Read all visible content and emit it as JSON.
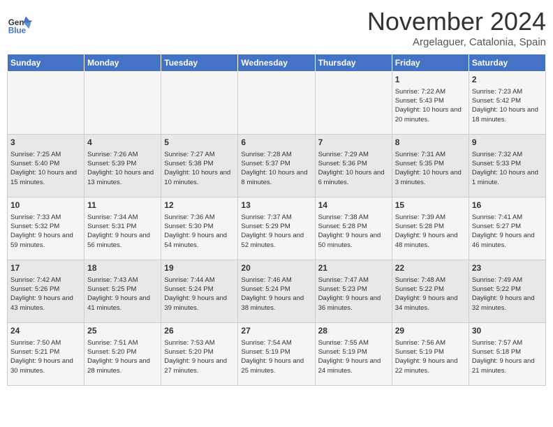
{
  "header": {
    "logo_line1": "General",
    "logo_line2": "Blue",
    "month": "November 2024",
    "location": "Argelaguer, Catalonia, Spain"
  },
  "weekdays": [
    "Sunday",
    "Monday",
    "Tuesday",
    "Wednesday",
    "Thursday",
    "Friday",
    "Saturday"
  ],
  "weeks": [
    [
      {
        "day": "",
        "info": ""
      },
      {
        "day": "",
        "info": ""
      },
      {
        "day": "",
        "info": ""
      },
      {
        "day": "",
        "info": ""
      },
      {
        "day": "",
        "info": ""
      },
      {
        "day": "1",
        "info": "Sunrise: 7:22 AM\nSunset: 5:43 PM\nDaylight: 10 hours and 20 minutes."
      },
      {
        "day": "2",
        "info": "Sunrise: 7:23 AM\nSunset: 5:42 PM\nDaylight: 10 hours and 18 minutes."
      }
    ],
    [
      {
        "day": "3",
        "info": "Sunrise: 7:25 AM\nSunset: 5:40 PM\nDaylight: 10 hours and 15 minutes."
      },
      {
        "day": "4",
        "info": "Sunrise: 7:26 AM\nSunset: 5:39 PM\nDaylight: 10 hours and 13 minutes."
      },
      {
        "day": "5",
        "info": "Sunrise: 7:27 AM\nSunset: 5:38 PM\nDaylight: 10 hours and 10 minutes."
      },
      {
        "day": "6",
        "info": "Sunrise: 7:28 AM\nSunset: 5:37 PM\nDaylight: 10 hours and 8 minutes."
      },
      {
        "day": "7",
        "info": "Sunrise: 7:29 AM\nSunset: 5:36 PM\nDaylight: 10 hours and 6 minutes."
      },
      {
        "day": "8",
        "info": "Sunrise: 7:31 AM\nSunset: 5:35 PM\nDaylight: 10 hours and 3 minutes."
      },
      {
        "day": "9",
        "info": "Sunrise: 7:32 AM\nSunset: 5:33 PM\nDaylight: 10 hours and 1 minute."
      }
    ],
    [
      {
        "day": "10",
        "info": "Sunrise: 7:33 AM\nSunset: 5:32 PM\nDaylight: 9 hours and 59 minutes."
      },
      {
        "day": "11",
        "info": "Sunrise: 7:34 AM\nSunset: 5:31 PM\nDaylight: 9 hours and 56 minutes."
      },
      {
        "day": "12",
        "info": "Sunrise: 7:36 AM\nSunset: 5:30 PM\nDaylight: 9 hours and 54 minutes."
      },
      {
        "day": "13",
        "info": "Sunrise: 7:37 AM\nSunset: 5:29 PM\nDaylight: 9 hours and 52 minutes."
      },
      {
        "day": "14",
        "info": "Sunrise: 7:38 AM\nSunset: 5:28 PM\nDaylight: 9 hours and 50 minutes."
      },
      {
        "day": "15",
        "info": "Sunrise: 7:39 AM\nSunset: 5:28 PM\nDaylight: 9 hours and 48 minutes."
      },
      {
        "day": "16",
        "info": "Sunrise: 7:41 AM\nSunset: 5:27 PM\nDaylight: 9 hours and 46 minutes."
      }
    ],
    [
      {
        "day": "17",
        "info": "Sunrise: 7:42 AM\nSunset: 5:26 PM\nDaylight: 9 hours and 43 minutes."
      },
      {
        "day": "18",
        "info": "Sunrise: 7:43 AM\nSunset: 5:25 PM\nDaylight: 9 hours and 41 minutes."
      },
      {
        "day": "19",
        "info": "Sunrise: 7:44 AM\nSunset: 5:24 PM\nDaylight: 9 hours and 39 minutes."
      },
      {
        "day": "20",
        "info": "Sunrise: 7:46 AM\nSunset: 5:24 PM\nDaylight: 9 hours and 38 minutes."
      },
      {
        "day": "21",
        "info": "Sunrise: 7:47 AM\nSunset: 5:23 PM\nDaylight: 9 hours and 36 minutes."
      },
      {
        "day": "22",
        "info": "Sunrise: 7:48 AM\nSunset: 5:22 PM\nDaylight: 9 hours and 34 minutes."
      },
      {
        "day": "23",
        "info": "Sunrise: 7:49 AM\nSunset: 5:22 PM\nDaylight: 9 hours and 32 minutes."
      }
    ],
    [
      {
        "day": "24",
        "info": "Sunrise: 7:50 AM\nSunset: 5:21 PM\nDaylight: 9 hours and 30 minutes."
      },
      {
        "day": "25",
        "info": "Sunrise: 7:51 AM\nSunset: 5:20 PM\nDaylight: 9 hours and 28 minutes."
      },
      {
        "day": "26",
        "info": "Sunrise: 7:53 AM\nSunset: 5:20 PM\nDaylight: 9 hours and 27 minutes."
      },
      {
        "day": "27",
        "info": "Sunrise: 7:54 AM\nSunset: 5:19 PM\nDaylight: 9 hours and 25 minutes."
      },
      {
        "day": "28",
        "info": "Sunrise: 7:55 AM\nSunset: 5:19 PM\nDaylight: 9 hours and 24 minutes."
      },
      {
        "day": "29",
        "info": "Sunrise: 7:56 AM\nSunset: 5:19 PM\nDaylight: 9 hours and 22 minutes."
      },
      {
        "day": "30",
        "info": "Sunrise: 7:57 AM\nSunset: 5:18 PM\nDaylight: 9 hours and 21 minutes."
      }
    ]
  ]
}
